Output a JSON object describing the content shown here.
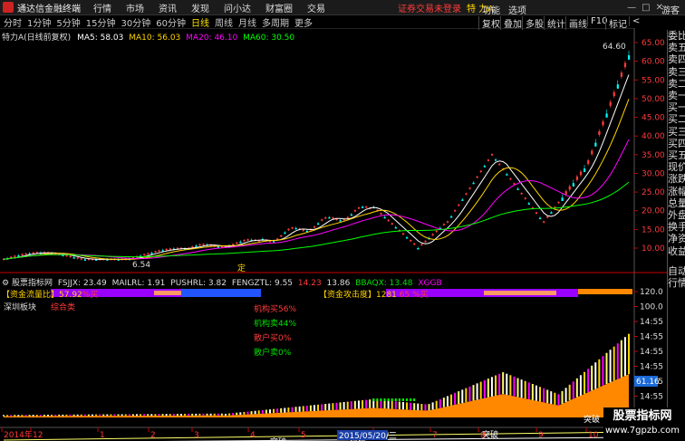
{
  "app": {
    "title": "通达信金融终端",
    "menu": [
      "行情",
      "市场",
      "资讯",
      "发现",
      "问小达",
      "财富圈",
      "交易"
    ],
    "login_warning": "证券交易未登录",
    "stock_title": "特 力A",
    "right_links": [
      "功能",
      "选项"
    ],
    "guest": "游客"
  },
  "periods": [
    "分时",
    "1分钟",
    "5分钟",
    "15分钟",
    "30分钟",
    "60分钟",
    "日线",
    "周线",
    "月线",
    "多周期",
    "更多"
  ],
  "active_period": "日线",
  "tools": [
    "复权",
    "叠加",
    "多股",
    "统计",
    "画线",
    "F10",
    "标记"
  ],
  "sidebar": [
    "委比",
    "卖五",
    "卖四",
    "卖三",
    "卖二",
    "卖一",
    "买一",
    "买二",
    "买三",
    "买四",
    "买五",
    "现价",
    "涨跌",
    "涨幅",
    "总量",
    "外盘",
    "换手",
    "净资",
    "收益",
    "自动",
    "行情"
  ],
  "main_legend": {
    "name": "特力A(日线前复权)",
    "ma5": "MA5: 58.03",
    "ma10": "MA10: 56.03",
    "ma20": "MA20: 46.10",
    "ma60": "MA60: 30.50"
  },
  "price_axis": [
    "65.00",
    "60.00",
    "55.00",
    "50.00",
    "45.00",
    "40.00",
    "35.00",
    "30.00",
    "25.00",
    "20.00",
    "15.00",
    "10.00"
  ],
  "price_labels": {
    "high": "64.60",
    "low": "6.54"
  },
  "sub_legend": {
    "name": "股票指标网",
    "fsjjx": "FSJJX: 23.49",
    "mailrl": "MAILRL: 1.91",
    "pushrl": "PUSHRL: 3.82",
    "fengztl": "FENGZTL: 9.55",
    "v1": "14.23",
    "v2": "13.86",
    "bbaqx": "BBAQX: 13.48",
    "xggb": "XGGB"
  },
  "sub_axis": [
    "120.0",
    "100.0",
    "14:55",
    "14:55",
    "14:55",
    "14:55",
    "14:55",
    "14:55",
    "14:55",
    "14:55"
  ],
  "sub_value_label": "61.16",
  "bars": {
    "left_label": "【资金流量比】57.92",
    "left_pct": "%买",
    "right_label": "【资金攻击度】1281",
    "right_pct": "65 %买"
  },
  "block": {
    "name": "深圳板块",
    "type": "综合类"
  },
  "flows": [
    {
      "label": "机构买56%",
      "color": "#ff3b3b"
    },
    {
      "label": "机构卖44%",
      "color": "#00e000"
    },
    {
      "label": "散户买0%",
      "color": "#ff3b3b"
    },
    {
      "label": "散户卖0%",
      "color": "#00e000"
    }
  ],
  "signals": {
    "breakout": "突破",
    "rise": "拉升",
    "settle": "定"
  },
  "date_axis": [
    "2014年",
    "12",
    "1",
    "2",
    "3",
    "4",
    "5",
    "6",
    "7",
    "8",
    "9",
    "10"
  ],
  "date_cursor": "2015/05/20/三",
  "watermark": {
    "line1": "股票指标网",
    "line2": "www.7gpzb.com"
  },
  "colors": {
    "ma5": "#ffffff",
    "ma10": "#ffd400",
    "ma20": "#ff00ff",
    "ma60": "#00ff00",
    "up": "#ff3b3b",
    "down": "#00ffff",
    "accent": "#ff8800"
  }
}
